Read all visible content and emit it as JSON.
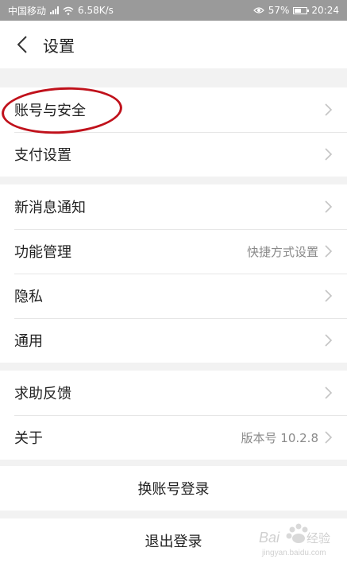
{
  "status_bar": {
    "carrier": "中国移动",
    "network_speed": "6.58K/s",
    "battery": "57%",
    "battery_level": 0.57,
    "time": "20:24"
  },
  "header": {
    "title": "设置"
  },
  "groups": [
    {
      "items": [
        {
          "label": "账号与安全"
        },
        {
          "label": "支付设置"
        }
      ]
    },
    {
      "items": [
        {
          "label": "新消息通知"
        },
        {
          "label": "功能管理",
          "value": "快捷方式设置"
        },
        {
          "label": "隐私"
        },
        {
          "label": "通用"
        }
      ]
    },
    {
      "items": [
        {
          "label": "求助反馈"
        },
        {
          "label": "关于",
          "value": "版本号 10.2.8"
        }
      ]
    }
  ],
  "actions": {
    "switch_account": "换账号登录",
    "logout": "退出登录"
  },
  "watermark": {
    "brand": "Baidu经验",
    "url": "jingyan.baidu.com"
  },
  "colors": {
    "annotation": "#c0111b",
    "status_bar": "#9a9a9a"
  }
}
